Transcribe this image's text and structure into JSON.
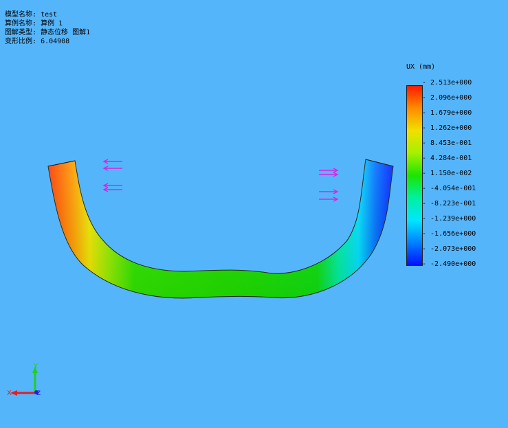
{
  "info": {
    "model_name_label": "模型名称:",
    "model_name_value": "test",
    "study_name_label": "算例名称:",
    "study_name_value": "算例 1",
    "plot_type_label": "图解类型:",
    "plot_type_value": "静态位移 图解1",
    "deformation_scale_label": "变形比例:",
    "deformation_scale_value": "6.04908"
  },
  "legend": {
    "title": "UX (mm)",
    "ticks": [
      "2.513e+000",
      "2.096e+000",
      "1.679e+000",
      "1.262e+000",
      "8.453e-001",
      "4.284e-001",
      "1.150e-002",
      "-4.054e-001",
      "-8.223e-001",
      "-1.239e+000",
      "-1.656e+000",
      "-2.073e+000",
      "-2.490e+000"
    ],
    "gradient_colors": [
      "#ff1a00",
      "#ff8c00",
      "#f0e000",
      "#a6f000",
      "#1ae600",
      "#00f0a0",
      "#00e6ff",
      "#0080ff",
      "#0010ff"
    ]
  },
  "colors": {
    "background": "#55b5fb",
    "load_arrow": "#e020e0",
    "axis_x": "#e02020",
    "axis_y": "#20d020",
    "axis_z": "#2020e0"
  },
  "triad": {
    "x_label": "X",
    "y_label": "Y",
    "z_label": "Z"
  }
}
